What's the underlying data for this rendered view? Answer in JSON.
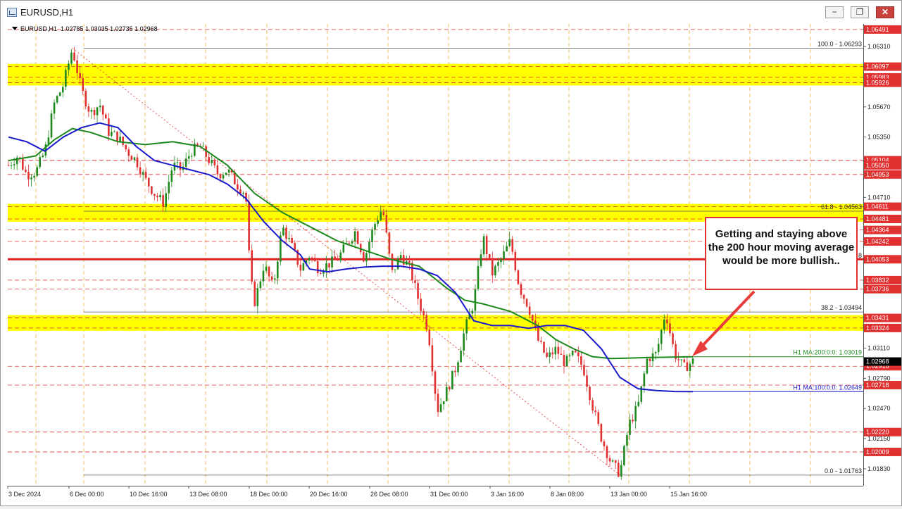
{
  "window": {
    "title": "EURUSD,H1",
    "minimize_glyph": "−",
    "restore_glyph": "❐",
    "close_glyph": "✕"
  },
  "chart_info": {
    "symbol_timeframe": "EURUSD,H1",
    "ohlc": "1.02785 1.03035 1.02735 1.02968"
  },
  "fib": {
    "level_100": "100.0 - 1.06293",
    "level_618": "61.8 - 1.04563",
    "level_382": "38.2 - 1.03494",
    "level_0": "0.0 - 1.01763",
    "level_50_partial": "8"
  },
  "ma_labels": {
    "ma200": "H1 MA:200:0:0: 1.03019",
    "ma100": "H1 MA:100:0:0: 1.02649"
  },
  "callout": {
    "text": "Getting and staying above the 200 hour moving average would be more bullish.."
  },
  "price_scale": {
    "plain": [
      "1.06310",
      "1.05670",
      "1.05350",
      "1.04710",
      "1.03110",
      "1.02790",
      "1.02470",
      "1.02150",
      "1.01830"
    ],
    "tagged": [
      "1.06491",
      "1.06097",
      "1.05983",
      "1.05926",
      "1.05104",
      "1.05050",
      "1.04953",
      "1.04611",
      "1.04481",
      "1.04364",
      "1.04242",
      "1.04053",
      "1.03832",
      "1.03736",
      "1.03431",
      "1.03324",
      "1.02918",
      "1.02718",
      "1.02220",
      "1.02009"
    ],
    "current": "1.02968",
    "hidden_partial": "1.04360"
  },
  "time_scale": [
    "3 Dec 2024",
    "6 Dec 00:00",
    "10 Dec 16:00",
    "13 Dec 08:00",
    "18 Dec 00:00",
    "20 Dec 16:00",
    "26 Dec 08:00",
    "31 Dec 00:00",
    "3 Jan 16:00",
    "8 Jan 08:00",
    "13 Jan 00:00",
    "15 Jan 16:00"
  ],
  "colors": {
    "background": "#ffffff",
    "zone_fill": "#ffff00",
    "level_line": "#e03030",
    "ma200": "#1e8a1e",
    "ma100": "#1a1acc",
    "candle_up": "#1e8a1e",
    "candle_down": "#e03030",
    "grid": "#e8b040"
  },
  "chart_data": {
    "type": "candlestick",
    "symbol": "EURUSD",
    "timeframe": "H1",
    "ylim": [
      1.0165,
      1.0655
    ],
    "last_close": 1.02968,
    "horizontal_levels": [
      1.06491,
      1.06097,
      1.05983,
      1.05926,
      1.05104,
      1.04953,
      1.04611,
      1.04481,
      1.04364,
      1.04242,
      1.04053,
      1.03832,
      1.03736,
      1.03431,
      1.03324,
      1.02918,
      1.02718,
      1.0222,
      1.02009
    ],
    "zones": [
      [
        1.05926,
        1.06097
      ],
      [
        1.04481,
        1.04611
      ],
      [
        1.03324,
        1.03431
      ]
    ],
    "fibonacci": {
      "100.0": 1.06293,
      "61.8": 1.04563,
      "38.2": 1.03494,
      "0.0": 1.01763
    },
    "moving_averages": [
      {
        "name": "H1 MA:200:0:0",
        "value": 1.03019
      },
      {
        "name": "H1 MA:100:0:0",
        "value": 1.02649
      }
    ],
    "price_path": [
      [
        0,
        1.0505
      ],
      [
        2,
        1.0515
      ],
      [
        4,
        1.0495
      ],
      [
        6,
        1.0498
      ],
      [
        8,
        1.052
      ],
      [
        10,
        1.057
      ],
      [
        12,
        1.059
      ],
      [
        14,
        1.0629
      ],
      [
        16,
        1.0585
      ],
      [
        18,
        1.056
      ],
      [
        20,
        1.057
      ],
      [
        22,
        1.054
      ],
      [
        24,
        1.0535
      ],
      [
        26,
        1.052
      ],
      [
        28,
        1.051
      ],
      [
        30,
        1.049
      ],
      [
        32,
        1.0475
      ],
      [
        34,
        1.0465
      ],
      [
        36,
        1.0505
      ],
      [
        38,
        1.05
      ],
      [
        40,
        1.052
      ],
      [
        42,
        1.0525
      ],
      [
        44,
        1.051
      ],
      [
        46,
        1.0495
      ],
      [
        48,
        1.05
      ],
      [
        50,
        1.0485
      ],
      [
        52,
        1.0475
      ],
      [
        53,
        1.0385
      ],
      [
        54,
        1.036
      ],
      [
        56,
        1.04
      ],
      [
        58,
        1.0375
      ],
      [
        60,
        1.044
      ],
      [
        62,
        1.042
      ],
      [
        64,
        1.0395
      ],
      [
        66,
        1.041
      ],
      [
        68,
        1.0395
      ],
      [
        70,
        1.04
      ],
      [
        72,
        1.0405
      ],
      [
        74,
        1.042
      ],
      [
        76,
        1.0435
      ],
      [
        78,
        1.0405
      ],
      [
        80,
        1.044
      ],
      [
        82,
        1.046
      ],
      [
        84,
        1.039
      ],
      [
        86,
        1.041
      ],
      [
        88,
        1.0395
      ],
      [
        90,
        1.036
      ],
      [
        92,
        1.033
      ],
      [
        94,
        1.0245
      ],
      [
        96,
        1.0265
      ],
      [
        98,
        1.029
      ],
      [
        100,
        1.033
      ],
      [
        102,
        1.036
      ],
      [
        104,
        1.043
      ],
      [
        106,
        1.039
      ],
      [
        108,
        1.0405
      ],
      [
        110,
        1.0425
      ],
      [
        112,
        1.0375
      ],
      [
        114,
        1.0355
      ],
      [
        116,
        1.032
      ],
      [
        118,
        1.03
      ],
      [
        120,
        1.031
      ],
      [
        122,
        1.0295
      ],
      [
        124,
        1.0305
      ],
      [
        126,
        1.029
      ],
      [
        128,
        1.025
      ],
      [
        130,
        1.0215
      ],
      [
        132,
        1.019
      ],
      [
        134,
        1.0178
      ],
      [
        136,
        1.023
      ],
      [
        138,
        1.025
      ],
      [
        140,
        1.03
      ],
      [
        142,
        1.0305
      ],
      [
        144,
        1.035
      ],
      [
        146,
        1.0305
      ],
      [
        148,
        1.029
      ],
      [
        150,
        1.0297
      ]
    ],
    "ma200_path": [
      [
        0,
        1.051
      ],
      [
        6,
        1.0515
      ],
      [
        10,
        1.0532
      ],
      [
        14,
        1.0544
      ],
      [
        18,
        1.054
      ],
      [
        24,
        1.053
      ],
      [
        30,
        1.0527
      ],
      [
        36,
        1.053
      ],
      [
        42,
        1.0525
      ],
      [
        48,
        1.0505
      ],
      [
        54,
        1.0475
      ],
      [
        60,
        1.0455
      ],
      [
        66,
        1.044
      ],
      [
        72,
        1.0425
      ],
      [
        78,
        1.0415
      ],
      [
        84,
        1.0405
      ],
      [
        90,
        1.0398
      ],
      [
        96,
        1.0375
      ],
      [
        100,
        1.0362
      ],
      [
        104,
        1.0358
      ],
      [
        110,
        1.035
      ],
      [
        116,
        1.0335
      ],
      [
        120,
        1.032
      ],
      [
        124,
        1.031
      ],
      [
        128,
        1.0302
      ],
      [
        132,
        1.03
      ],
      [
        140,
        1.0301
      ],
      [
        150,
        1.03019
      ]
    ],
    "ma100_path": [
      [
        0,
        1.0535
      ],
      [
        4,
        1.053
      ],
      [
        8,
        1.052
      ],
      [
        12,
        1.0535
      ],
      [
        16,
        1.0545
      ],
      [
        20,
        1.055
      ],
      [
        24,
        1.0545
      ],
      [
        28,
        1.0525
      ],
      [
        32,
        1.051
      ],
      [
        36,
        1.0505
      ],
      [
        40,
        1.05
      ],
      [
        44,
        1.0495
      ],
      [
        48,
        1.0485
      ],
      [
        52,
        1.047
      ],
      [
        56,
        1.0445
      ],
      [
        60,
        1.0425
      ],
      [
        64,
        1.041
      ],
      [
        66,
        1.0395
      ],
      [
        70,
        1.0392
      ],
      [
        74,
        1.0395
      ],
      [
        78,
        1.0397
      ],
      [
        82,
        1.0398
      ],
      [
        86,
        1.0398
      ],
      [
        90,
        1.0395
      ],
      [
        94,
        1.0388
      ],
      [
        98,
        1.037
      ],
      [
        102,
        1.034
      ],
      [
        106,
        1.0335
      ],
      [
        110,
        1.0335
      ],
      [
        114,
        1.0332
      ],
      [
        118,
        1.0335
      ],
      [
        122,
        1.0335
      ],
      [
        126,
        1.033
      ],
      [
        130,
        1.031
      ],
      [
        134,
        1.028
      ],
      [
        138,
        1.0268
      ],
      [
        142,
        1.0266
      ],
      [
        146,
        1.0265
      ],
      [
        150,
        1.02649
      ]
    ]
  }
}
